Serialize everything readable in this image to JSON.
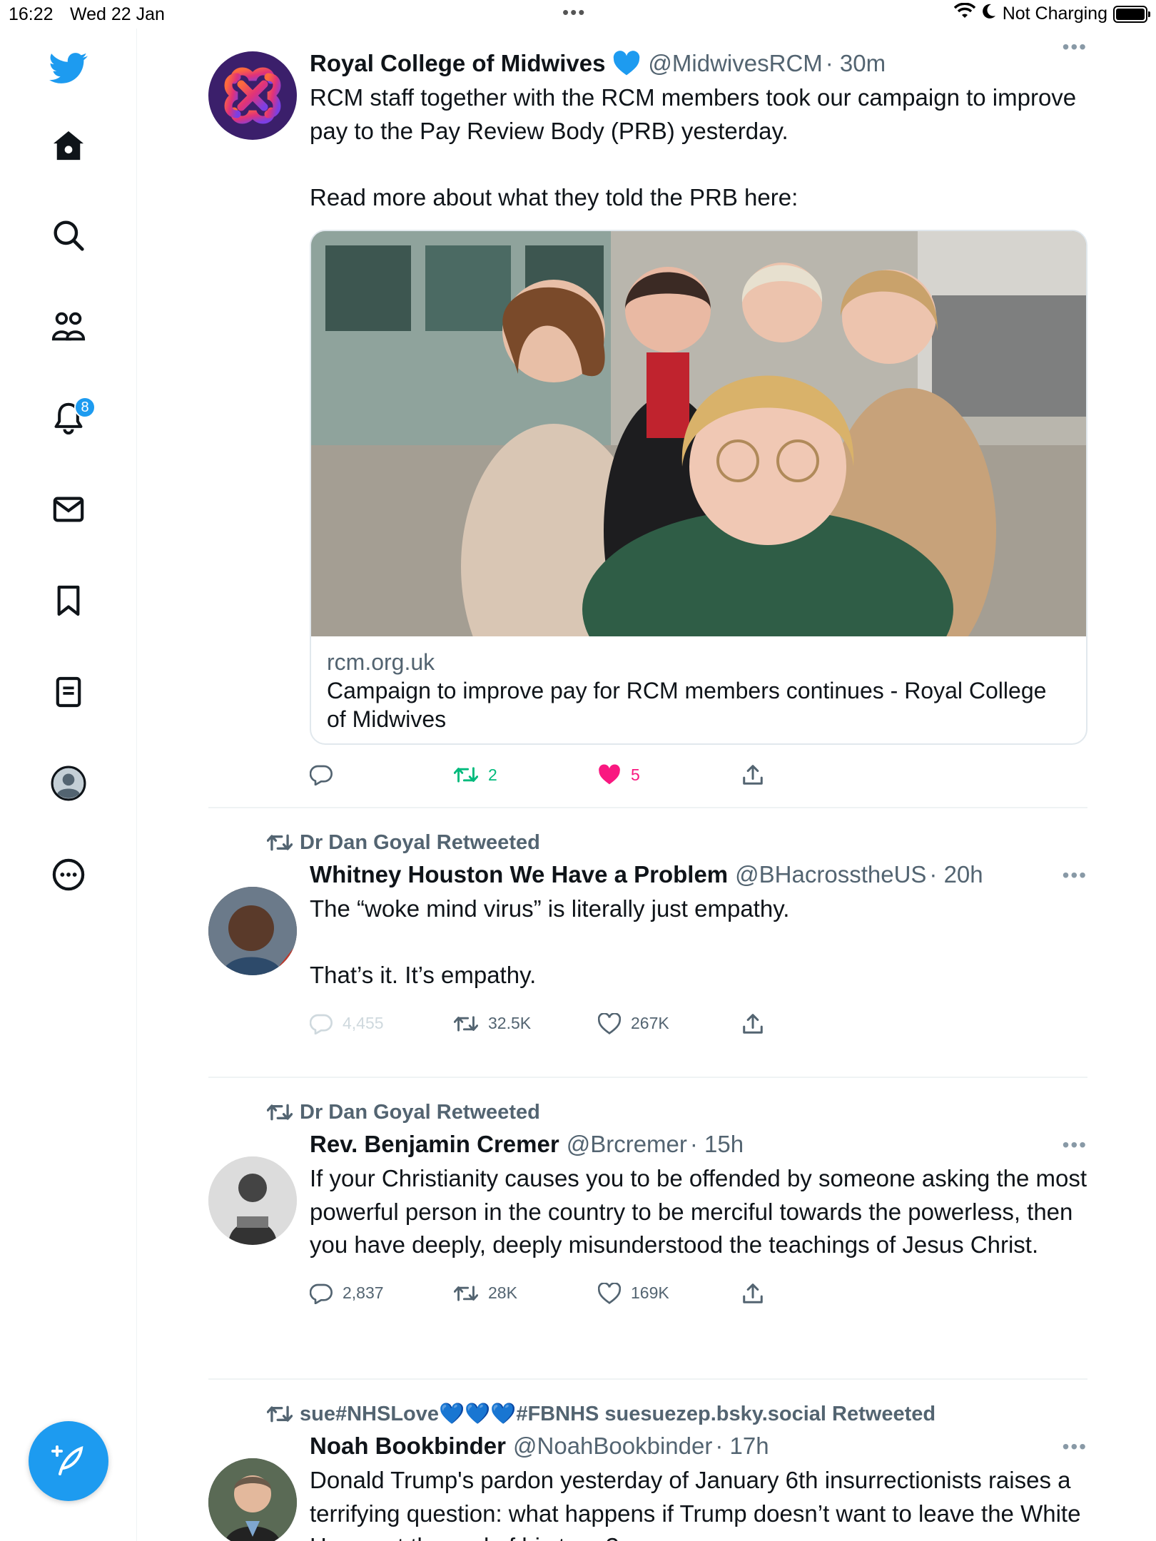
{
  "status_bar": {
    "time": "16:22",
    "date": "Wed 22 Jan",
    "charging": "Not Charging",
    "multitask_dots": "•••"
  },
  "sidebar": {
    "items": [
      {
        "name": "home-icon"
      },
      {
        "name": "search-icon"
      },
      {
        "name": "communities-icon"
      },
      {
        "name": "notifications-icon",
        "badge": "8"
      },
      {
        "name": "messages-icon"
      },
      {
        "name": "bookmarks-icon"
      },
      {
        "name": "lists-icon"
      },
      {
        "name": "profile-icon"
      },
      {
        "name": "more-icon"
      }
    ],
    "accent": "#1d9bf0"
  },
  "tweets": [
    {
      "retweeted_by": "",
      "name": "Royal College of Midwives",
      "verified": true,
      "handle": "@MidwivesRCM",
      "time": "· 30m",
      "text": "RCM staff together with the RCM members took our campaign to improve pay to the Pay Review Body (PRB) yesterday.\n\nRead more about what they told the PRB here:",
      "card": {
        "domain": "rcm.org.uk",
        "title": "Campaign to improve pay for RCM members continues - Royal College of Midwives"
      },
      "replies": "",
      "retweets": "2",
      "likes": "5"
    },
    {
      "retweeted_by": "Dr Dan Goyal Retweeted",
      "name": "Whitney Houston We Have a Problem",
      "handle": "@BHacrosstheUS",
      "time": "· 20h",
      "text": "The “woke mind virus” is literally just empathy.\n\nThat’s it. It’s empathy.",
      "replies": "4,455",
      "retweets": "32.5K",
      "likes": "267K"
    },
    {
      "retweeted_by": "Dr Dan Goyal Retweeted",
      "name": "Rev. Benjamin Cremer",
      "handle": "@Brcremer",
      "time": "· 15h",
      "text": "If your Christianity causes you to be offended by someone asking the most powerful person in the country to be merciful towards the powerless, then you have deeply, deeply misunderstood the teachings of Jesus Christ.",
      "replies": "2,837",
      "retweets": "28K",
      "likes": "169K"
    },
    {
      "retweeted_by": "sue#NHSLove💙💙💙#FBNHS suesuezep.bsky.social Retweeted",
      "name": "Noah Bookbinder",
      "handle": "@NoahBookbinder",
      "time": "· 17h",
      "text": "Donald Trump's pardon yesterday of January 6th insurrectionists raises a terrifying question: what happens if Trump doesn’t want to leave the White House at the end of his term?"
    }
  ],
  "colors": {
    "retweet_active": "#00ba7c",
    "like_active": "#f91880",
    "secondary_text": "#536471",
    "brand_blue": "#1d9bf0"
  }
}
